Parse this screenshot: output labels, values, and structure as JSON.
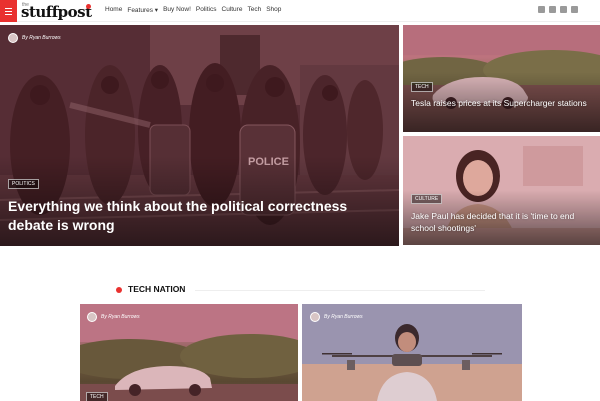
{
  "header": {
    "logo_small": "the",
    "logo": "stuffpost",
    "nav": [
      "Home",
      "Features ▾",
      "Buy Now!",
      "Politics",
      "Culture",
      "Tech",
      "Shop"
    ],
    "social_icons": [
      "facebook-icon",
      "twitter-icon",
      "youtube-icon",
      "instagram-icon"
    ]
  },
  "hero": {
    "byline": "By Ryan Burrows",
    "tag": "POLITICS",
    "title": "Everything we think about the political correctness debate is wrong"
  },
  "side_cards": [
    {
      "tag": "TECH",
      "title": "Tesla raises prices at its Supercharger stations"
    },
    {
      "tag": "CULTURE",
      "title": "Jake Paul has decided that it is 'time to end school shootings'"
    }
  ],
  "section": {
    "title": "TECH NATION"
  },
  "bottom_cards": [
    {
      "byline": "By Ryan Burrows",
      "tag": "TECH"
    },
    {
      "byline": "By Ryan Burrows"
    }
  ],
  "colors": {
    "accent": "#e9312f",
    "overlay": "#a02837"
  }
}
